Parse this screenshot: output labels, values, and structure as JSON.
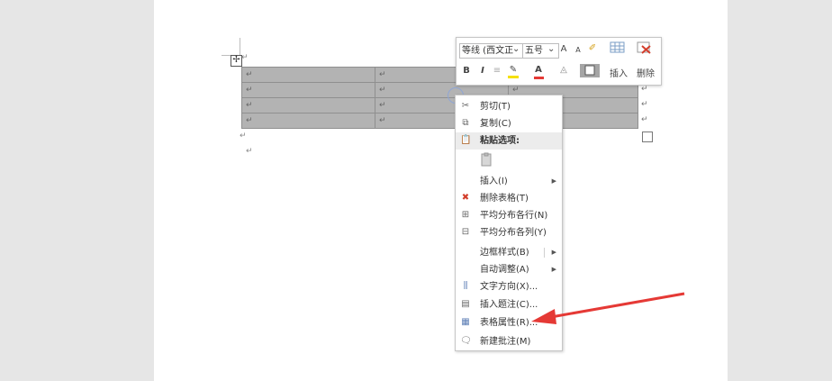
{
  "mini_toolbar": {
    "font_name": "等线 (西文正",
    "font_size": "五号",
    "grow_font": "A",
    "shrink_font": "A",
    "bold": "B",
    "italic": "I",
    "font_color": "A",
    "insert_label": "插入",
    "delete_label": "删除"
  },
  "context_menu": {
    "cut": "剪切(T)",
    "copy": "复制(C)",
    "paste_options": "粘贴选项:",
    "insert": "插入(I)",
    "delete_table": "删除表格(T)",
    "distribute_rows": "平均分布各行(N)",
    "distribute_columns": "平均分布各列(Y)",
    "border_styles": "边框样式(B)",
    "autofit": "自动调整(A)",
    "text_direction": "文字方向(X)...",
    "insert_caption": "插入题注(C)...",
    "table_properties": "表格属性(R)...",
    "new_comment": "新建批注(M)"
  },
  "document": {
    "paragraph_mark": "↵",
    "table_handle": "✢"
  },
  "colors": {
    "selection": "#b3b3b3",
    "arrow": "#e53935",
    "font_color_bar": "#e53935",
    "highlight_bar": "#f5e000"
  }
}
